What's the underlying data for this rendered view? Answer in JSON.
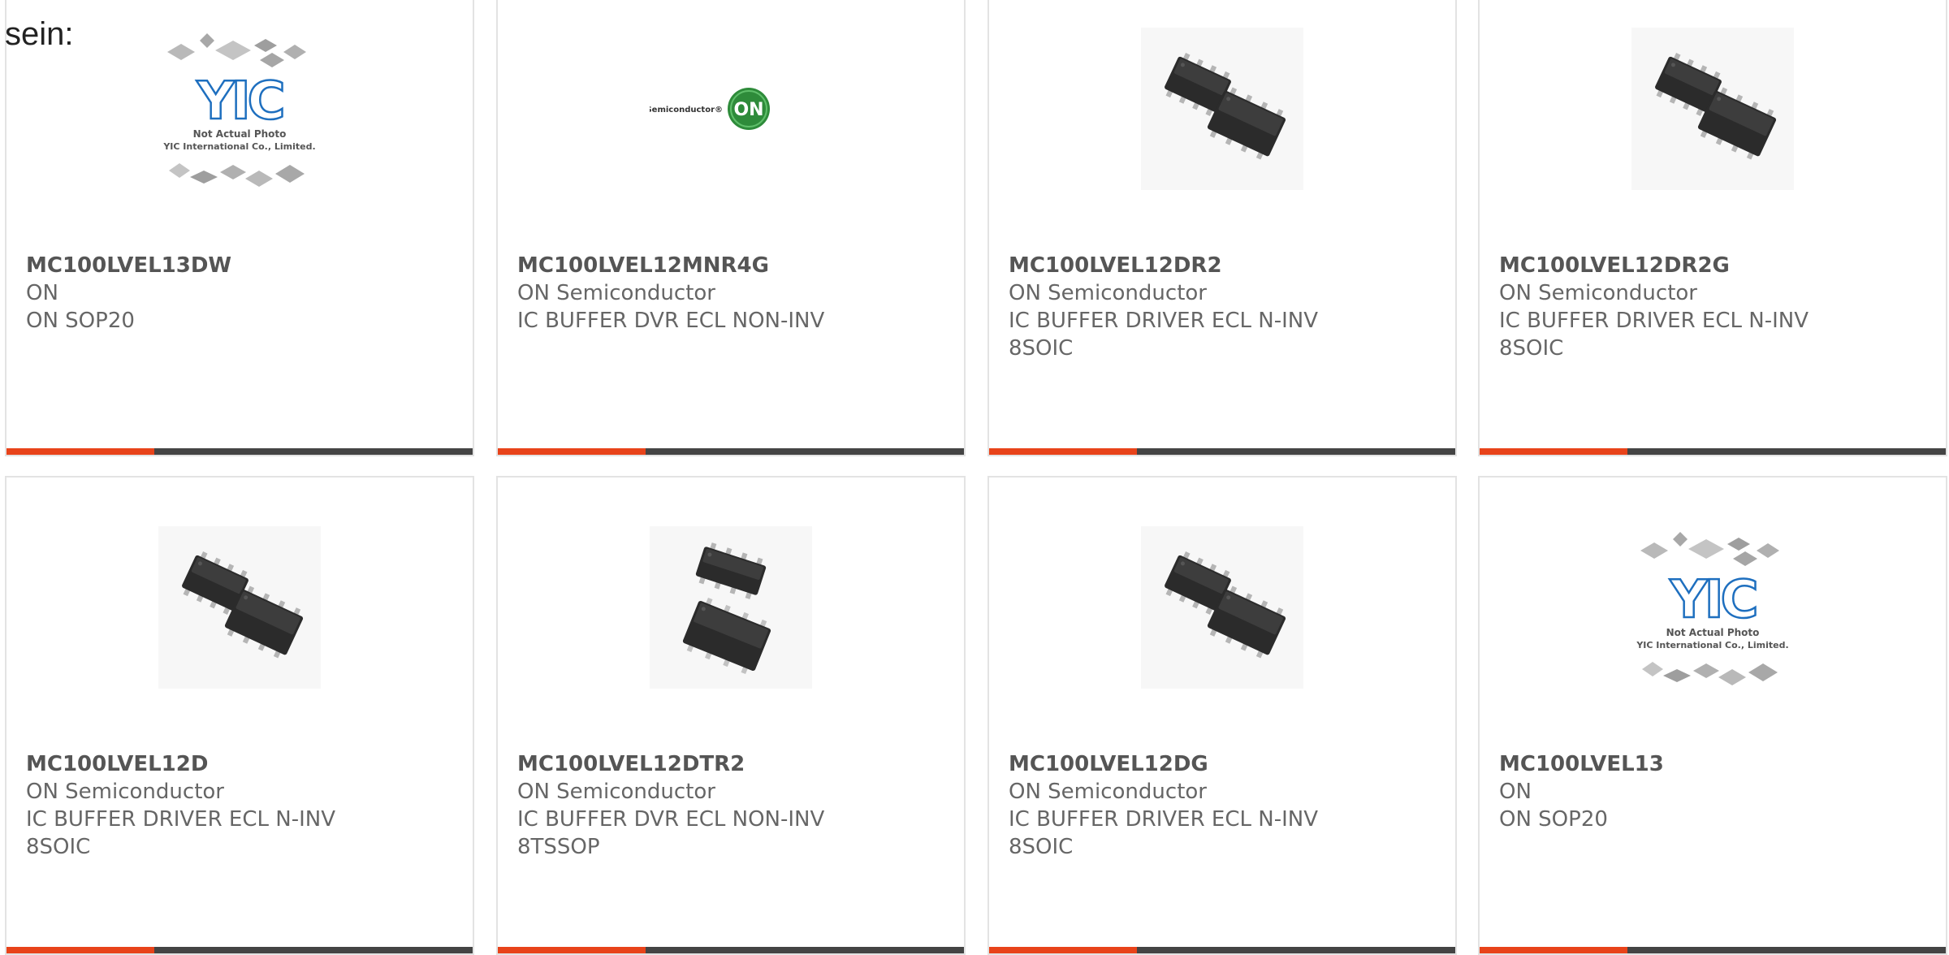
{
  "lead_text": "sein:",
  "colors": {
    "accent": "#e8431a",
    "bar_dark": "#444444",
    "card_border": "#e3e3e3",
    "on_logo_green": "#2e8b3a"
  },
  "products": [
    {
      "part": "MC100LVEL13DW",
      "lines": [
        "ON",
        "ON SOP20"
      ],
      "image": "yic-placeholder-photo",
      "placeholder": {
        "line1": "Not Actual Photo",
        "line2": "YIC International Co., Limited."
      }
    },
    {
      "part": "MC100LVEL12MNR4G",
      "lines": [
        "ON Semiconductor",
        "IC BUFFER DVR ECL NON-INV"
      ],
      "image": "on-semiconductor-logo",
      "logo_text": "ON Semiconductor®",
      "logo_badge": "ON"
    },
    {
      "part": "MC100LVEL12DR2",
      "lines": [
        "ON Semiconductor",
        "IC BUFFER DRIVER ECL N-INV",
        "8SOIC"
      ],
      "image": "soic-chip-photo"
    },
    {
      "part": "MC100LVEL12DR2G",
      "lines": [
        "ON Semiconductor",
        "IC BUFFER DRIVER ECL N-INV",
        "8SOIC"
      ],
      "image": "soic-chip-photo"
    },
    {
      "part": "MC100LVEL12D",
      "lines": [
        "ON Semiconductor",
        "IC BUFFER DRIVER ECL N-INV",
        "8SOIC"
      ],
      "image": "soic-chip-photo"
    },
    {
      "part": "MC100LVEL12DTR2",
      "lines": [
        "ON Semiconductor",
        "IC BUFFER DVR ECL NON-INV",
        "8TSSOP"
      ],
      "image": "tssop-chip-photo"
    },
    {
      "part": "MC100LVEL12DG",
      "lines": [
        "ON Semiconductor",
        "IC BUFFER DRIVER ECL N-INV",
        "8SOIC"
      ],
      "image": "soic-chip-photo"
    },
    {
      "part": "MC100LVEL13",
      "lines": [
        "ON",
        "ON SOP20"
      ],
      "image": "yic-placeholder-photo",
      "placeholder": {
        "line1": "Not Actual Photo",
        "line2": "YIC International Co., Limited."
      }
    }
  ]
}
